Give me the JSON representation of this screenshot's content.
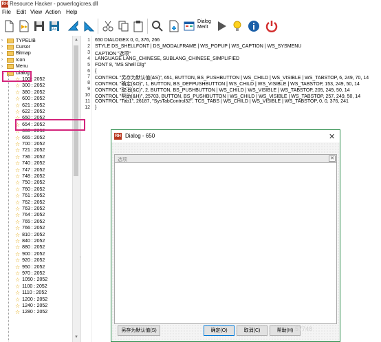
{
  "app": {
    "title": "Resource Hacker - powerlogicres.dll",
    "icon_text": "RH"
  },
  "menu": [
    "File",
    "Edit",
    "View",
    "Action",
    "Help"
  ],
  "toolbar": {
    "icons": [
      "new-icon",
      "open-icon",
      "save-icon",
      "save-as-icon",
      "back-icon",
      "forward-icon",
      "cut-icon",
      "copy-icon",
      "paste-icon",
      "find-icon",
      "add-resource-icon",
      "dialog-menu-icon",
      "run-script-icon",
      "hint-icon",
      "about-icon",
      "power-icon"
    ],
    "dialog_menu_line1": "Dialog",
    "dialog_menu_line2": "Merit"
  },
  "tree": {
    "top_items": [
      {
        "label": "TYPELIB",
        "expander": "›"
      },
      {
        "label": "Cursor",
        "expander": "›"
      },
      {
        "label": "Bitmap",
        "expander": "›"
      },
      {
        "label": "Icon",
        "expander": "›"
      },
      {
        "label": "Menu",
        "expander": "›"
      },
      {
        "label": "Dialog",
        "expander": "⌄"
      }
    ],
    "dialog_items": [
      "100 : 2052",
      "300 : 2052",
      "380 : 2052",
      "600 : 2052",
      "621 : 2052",
      "622 : 2052",
      "650 : 2052",
      "654 : 2052",
      "660 : 2052",
      "665 : 2052",
      "700 : 2052",
      "721 : 2052",
      "736 : 2052",
      "740 : 2052",
      "747 : 2052",
      "748 : 2052",
      "750 : 2052",
      "760 : 2052",
      "761 : 2052",
      "762 : 2052",
      "763 : 2052",
      "764 : 2052",
      "765 : 2052",
      "766 : 2052",
      "810 : 2052",
      "840 : 2052",
      "880 : 2052",
      "900 : 2052",
      "920 : 2052",
      "950 : 2052",
      "970 : 2052",
      "1050 : 2052",
      "1100 : 2052",
      "1110 : 2052",
      "1200 : 2052",
      "1240 : 2052",
      "1280 : 2052"
    ],
    "selected": "650 : 2052"
  },
  "editor": {
    "lines": [
      "650 DIALOGEX 0, 0, 376, 266",
      "STYLE DS_SHELLFONT | DS_MODALFRAME | WS_POPUP | WS_CAPTION | WS_SYSMENU",
      "CAPTION \"选项\"",
      "LANGUAGE LANG_CHINESE, SUBLANG_CHINESE_SIMPLIFIED",
      "FONT 8, \"MS Shell Dlg\"",
      "{",
      "   CONTROL \"另存为默认值(&S)\", 651, BUTTON, BS_PUSHBUTTON | WS_CHILD | WS_VISIBLE | WS_TABSTOP, 6, 249, 70, 14",
      "   CONTROL \"确定(&O)\", 1, BUTTON, BS_DEFPUSHBUTTON | WS_CHILD | WS_VISIBLE | WS_TABSTOP, 153, 249, 50, 14",
      "   CONTROL \"取消(&C)\", 2, BUTTON, BS_PUSHBUTTON | WS_CHILD | WS_VISIBLE | WS_TABSTOP, 205, 249, 50, 14",
      "   CONTROL \"帮助(&H)\", 25703, BUTTON, BS_PUSHBUTTON | WS_CHILD | WS_VISIBLE | WS_TABSTOP, 257, 249, 50, 14",
      "   CONTROL \"Tab1\", 26187, \"SysTabControl32\", TCS_TABS | WS_CHILD | WS_VISIBLE | WS_TABSTOP, 0, 0, 376, 241",
      "}"
    ]
  },
  "dialog": {
    "icon_text": "RH",
    "caption": "Dialog - 650",
    "close_glyph": "✕",
    "tab_label": "选项",
    "tab_close_glyph": "✕",
    "buttons": {
      "save_default": "另存为默认值(S)",
      "ok": "确定(O)",
      "cancel": "取消(C)",
      "help": "帮助(H)"
    }
  },
  "watermark": "…57748",
  "colors": {
    "highlight": "#d3247b",
    "dialog_border": "#2a8c4a",
    "folder": "#f3c75a"
  }
}
